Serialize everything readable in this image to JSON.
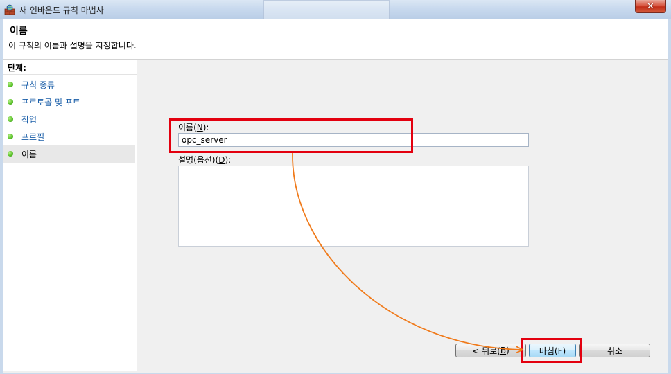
{
  "window": {
    "title": "새 인바운드 규칙 마법사",
    "close_symbol": "✕"
  },
  "header": {
    "title": "이름",
    "description": "이 규칙의 이름과 설명을 지정합니다."
  },
  "steps": {
    "heading": "단계:",
    "items": [
      {
        "label": "규칙 종류",
        "active": false
      },
      {
        "label": "프로토콜 및 포트",
        "active": false
      },
      {
        "label": "작업",
        "active": false
      },
      {
        "label": "프로필",
        "active": false
      },
      {
        "label": "이름",
        "active": true
      }
    ]
  },
  "form": {
    "name_label_prefix": "이름(",
    "name_label_key": "N",
    "name_label_suffix": "):",
    "name_value": "opc_server",
    "desc_label_prefix": "설명(옵션)(",
    "desc_label_key": "D",
    "desc_label_suffix": "):",
    "desc_value": ""
  },
  "buttons": {
    "back_prefix": "< 뒤로(",
    "back_key": "B",
    "back_suffix": ")",
    "finish_label": "마침(F)",
    "cancel_label": "취소"
  },
  "annotations": {
    "highlight_color": "#e3000f",
    "arrow_color": "#f07a1a"
  },
  "icons": {
    "app": "firewall-wizard-icon",
    "close": "close-icon",
    "step": "green-dot-icon"
  }
}
